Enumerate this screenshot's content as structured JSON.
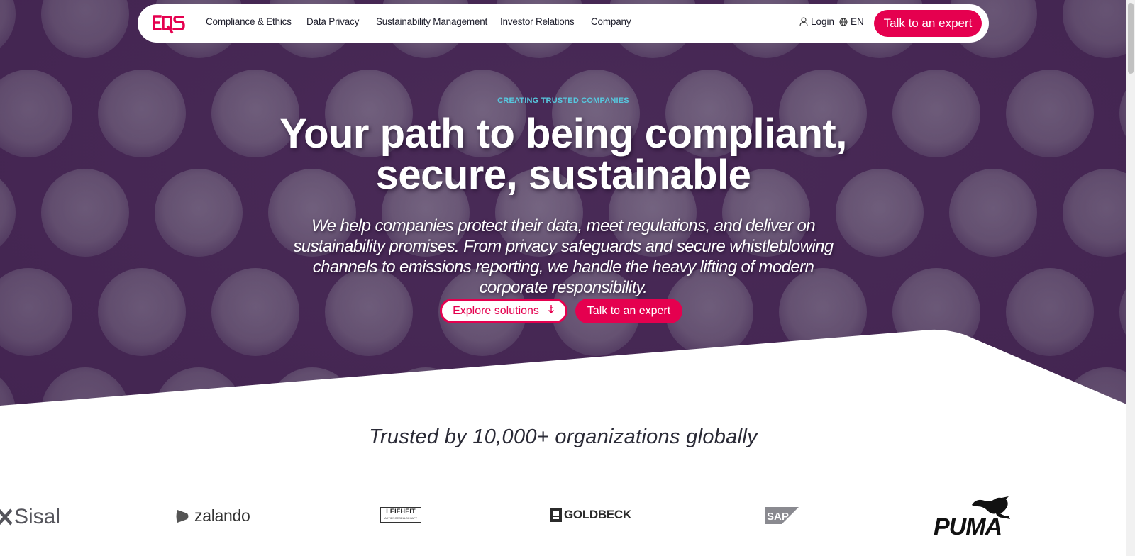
{
  "nav": {
    "logo_text": "EQS",
    "items": [
      {
        "label": "Compliance & Ethics"
      },
      {
        "label": "Data Privacy"
      },
      {
        "label": "Sustainability Management"
      },
      {
        "label": "Investor Relations"
      },
      {
        "label": "Company"
      }
    ],
    "login_label": "Login",
    "language_label": "EN",
    "cta_label": "Talk to an expert"
  },
  "hero": {
    "eyebrow": "CREATING TRUSTED COMPANIES",
    "headline_line1": "Your path to being compliant,",
    "headline_line2": "secure, sustainable",
    "subtext": "We help companies protect their data, meet regulations, and deliver on sustainability promises. From privacy safeguards and secure whistleblowing channels to emissions reporting, we handle the heavy lifting of modern corporate responsibility.",
    "primary_button_label": "Explore solutions",
    "secondary_button_label": "Talk to an expert"
  },
  "trusted": {
    "heading": "Trusted by 10,000+ organizations globally",
    "logos": [
      {
        "name": "Sisal"
      },
      {
        "name": "zalando"
      },
      {
        "name": "LEIFHEIT",
        "sub": "AKTIENGESELLSCHAFT"
      },
      {
        "name": "GOLDBECK"
      },
      {
        "name": "SAP"
      },
      {
        "name": "PUMA"
      }
    ]
  },
  "colors": {
    "accent": "#e5004f",
    "eyebrow": "#57c8df",
    "hero_background": "#4e2f5b"
  },
  "icons": {
    "login": "user-icon",
    "language": "globe-icon",
    "explore": "arrow-down-icon"
  }
}
